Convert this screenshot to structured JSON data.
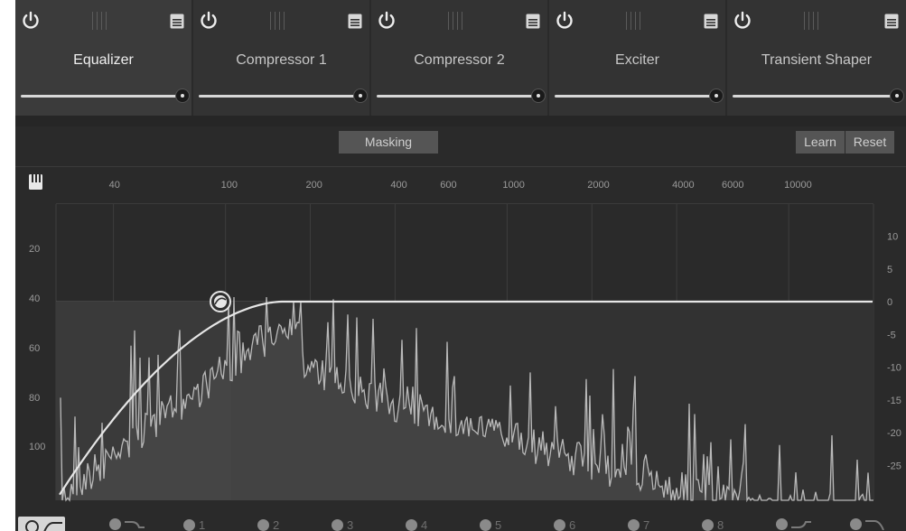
{
  "modules": [
    {
      "title": "Equalizer",
      "active": true
    },
    {
      "title": "Compressor 1",
      "active": false
    },
    {
      "title": "Compressor 2",
      "active": false
    },
    {
      "title": "Exciter",
      "active": false
    },
    {
      "title": "Transient Shaper",
      "active": false
    }
  ],
  "icons": {
    "power": "power-icon",
    "grip": "drag-handle-icon",
    "menu": "module-menu-icon",
    "keyboard": "piano-keyboard-icon",
    "node": "eq-node-icon"
  },
  "controls": {
    "masking_label": "Masking",
    "learn_label": "Learn",
    "reset_label": "Reset"
  },
  "graph": {
    "freq_ticks": [
      "40",
      "100",
      "200",
      "400",
      "600",
      "1000",
      "2000",
      "4000",
      "6000",
      "10000"
    ],
    "left_ticks": [
      "20",
      "40",
      "60",
      "80",
      "100"
    ],
    "right_ticks": [
      "10",
      "5",
      "0",
      "-5",
      "-10",
      "-15",
      "-20",
      "-25"
    ]
  },
  "bands": [
    {
      "label": "",
      "shape": "high-pass"
    },
    {
      "label": "",
      "shape": "low-shelf"
    },
    {
      "label": "1",
      "shape": "bell"
    },
    {
      "label": "2",
      "shape": "bell"
    },
    {
      "label": "3",
      "shape": "bell"
    },
    {
      "label": "4",
      "shape": "bell"
    },
    {
      "label": "5",
      "shape": "bell"
    },
    {
      "label": "6",
      "shape": "bell"
    },
    {
      "label": "7",
      "shape": "bell"
    },
    {
      "label": "8",
      "shape": "bell"
    },
    {
      "label": "",
      "shape": "high-shelf"
    },
    {
      "label": "",
      "shape": "low-pass"
    }
  ],
  "colors": {
    "background": "#2a2a2a",
    "module_bg": "#333333",
    "curve": "#e6e6e6",
    "spectrum": "#b9b9b9",
    "spectrum_fill": "#4a4a4a"
  }
}
